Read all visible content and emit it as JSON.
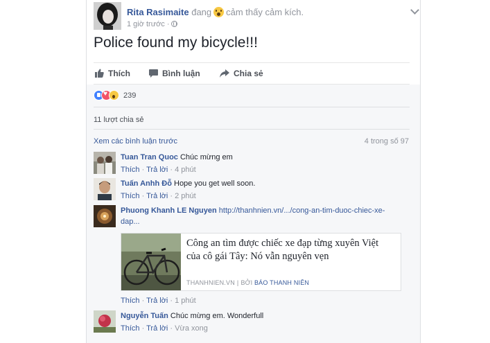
{
  "post": {
    "author": "Rita Rasimaite",
    "feeling_verb": "đang",
    "feeling_emoji": "wow-face-icon",
    "feeling_text": "cảm thấy cảm kích.",
    "time": "1 giờ trước",
    "privacy_icon": "globe-icon",
    "text": "Police found my bicycle!!!"
  },
  "actions": {
    "like": "Thích",
    "comment": "Bình luận",
    "share": "Chia sẻ"
  },
  "reactions": {
    "types": [
      "like",
      "love",
      "wow"
    ],
    "count": "239"
  },
  "shares": "11 lượt chia sẻ",
  "comments_header": {
    "view_previous": "Xem các bình luận trước",
    "count_of": "4 trong số 97"
  },
  "comments": [
    {
      "name": "Tuan Tran Quoc",
      "text": "Chúc mừng em",
      "like": "Thích",
      "reply": "Trả lời",
      "time": "4 phút"
    },
    {
      "name": "Tuấn Anhh Đỗ",
      "text": "Hope you get well soon.",
      "like": "Thích",
      "reply": "Trả lời",
      "time": "2 phút"
    },
    {
      "name": "Phuong Khanh LE Nguyen",
      "link_1": "http://thanhnien.vn/.../cong-an-tim-duoc-chiec-xe-",
      "link_2": "dap...",
      "like": "Thích",
      "reply": "Trả lời",
      "time": "1 phút",
      "preview": {
        "title": "Công an tìm được chiếc xe đạp từng xuyên Việt của cô gái Tây: Nó vẫn nguyên vẹn",
        "domain": "THANHNIEN.VN",
        "by": "BỞI",
        "publisher": "BÁO THANH NIÊN"
      }
    },
    {
      "name": "Nguyễn Tuấn",
      "text": "Chúc mừng em. Wonderfull",
      "like": "Thích",
      "reply": "Trả lời",
      "time": "Vừa xong"
    }
  ]
}
